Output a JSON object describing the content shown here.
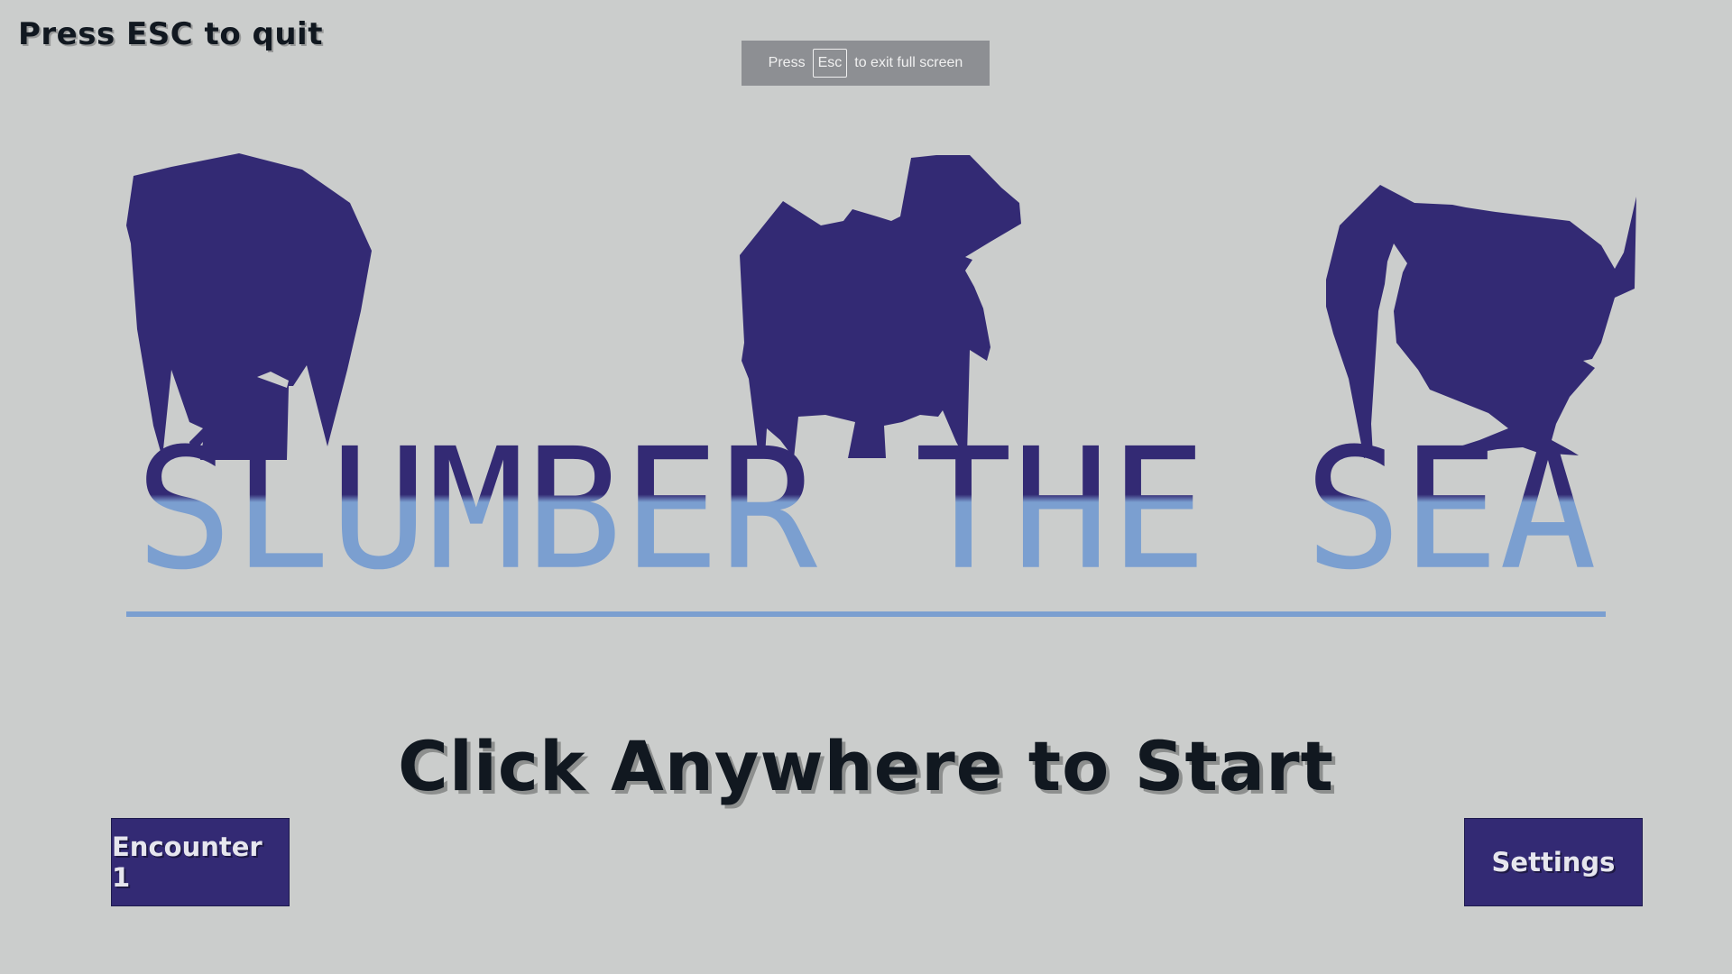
{
  "hud": {
    "quit_hint": "Press ESC to quit"
  },
  "fullscreen_toast": {
    "press": "Press",
    "key": "Esc",
    "suffix": "to exit full screen"
  },
  "title": {
    "text": "SLUMBER THE SEA"
  },
  "prompt": {
    "start": "Click Anywhere to Start"
  },
  "buttons": {
    "encounter": "Encounter 1",
    "settings": "Settings"
  },
  "colors": {
    "background": "#cbcdcc",
    "creature": "#332a74",
    "title_top": "#332a74",
    "title_bottom": "#7b9fd0",
    "button": "#332a74"
  }
}
